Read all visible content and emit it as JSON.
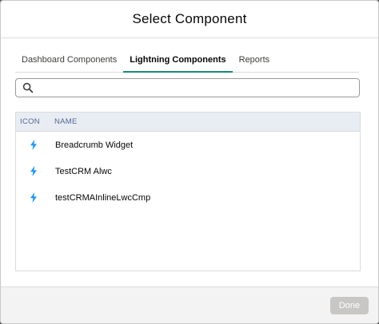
{
  "modal": {
    "title": "Select Component"
  },
  "tabs": [
    {
      "label": "Dashboard Components",
      "active": false
    },
    {
      "label": "Lightning Components",
      "active": true
    },
    {
      "label": "Reports",
      "active": false
    }
  ],
  "search": {
    "value": "",
    "placeholder": "",
    "icon": "search-icon"
  },
  "table": {
    "columns": {
      "icon": "ICON",
      "name": "NAME"
    },
    "rows": [
      {
        "icon": "lightning-bolt-icon",
        "name": "Breadcrumb Widget"
      },
      {
        "icon": "lightning-bolt-icon",
        "name": "TestCRM Alwc"
      },
      {
        "icon": "lightning-bolt-icon",
        "name": "testCRMAInlineLwcCmp"
      }
    ]
  },
  "footer": {
    "done_label": "Done",
    "done_disabled": true
  },
  "colors": {
    "active_tab_underline": "#1b8a76",
    "bolt": "#1b96ff",
    "header_row": "#e8edf4"
  }
}
